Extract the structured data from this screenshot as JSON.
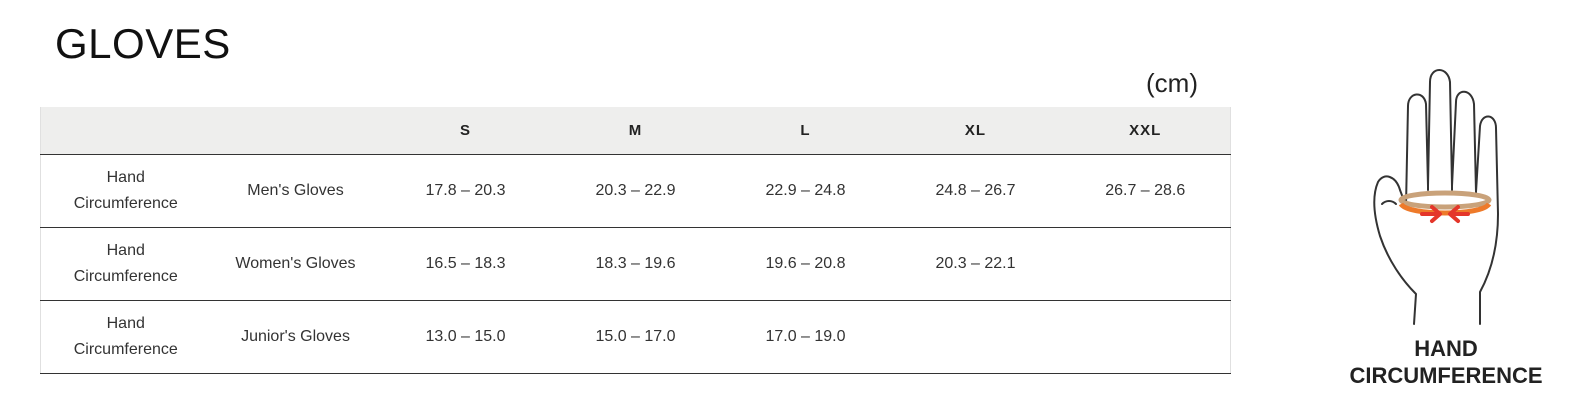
{
  "title": "GLOVES",
  "unit": "(cm)",
  "table": {
    "headers": [
      "",
      "",
      "S",
      "M",
      "L",
      "XL",
      "XXL"
    ],
    "rows": [
      {
        "measure_line1": "Hand",
        "measure_line2": "Circumference",
        "type": "Men's Gloves",
        "sizes": [
          "17.8 – 20.3",
          "20.3 – 22.9",
          "22.9 – 24.8",
          "24.8 – 26.7",
          "26.7 – 28.6"
        ]
      },
      {
        "measure_line1": "Hand",
        "measure_line2": "Circumference",
        "type": "Women's Gloves",
        "sizes": [
          "16.5 – 18.3",
          "18.3 – 19.6",
          "19.6 – 20.8",
          "20.3 – 22.1",
          ""
        ]
      },
      {
        "measure_line1": "Hand",
        "measure_line2": "Circumference",
        "type": "Junior's Gloves",
        "sizes": [
          "13.0 – 15.0",
          "15.0 – 17.0",
          "17.0 – 19.0",
          "",
          ""
        ]
      }
    ]
  },
  "figure": {
    "icon": "hand-circumference-icon",
    "caption_line1": "HAND",
    "caption_line2": "CIRCUMFERENCE",
    "colors": {
      "outline": "#333333",
      "band": "#c9a27a",
      "front_band": "#ee7a2a",
      "arrow": "#e4362a"
    }
  }
}
